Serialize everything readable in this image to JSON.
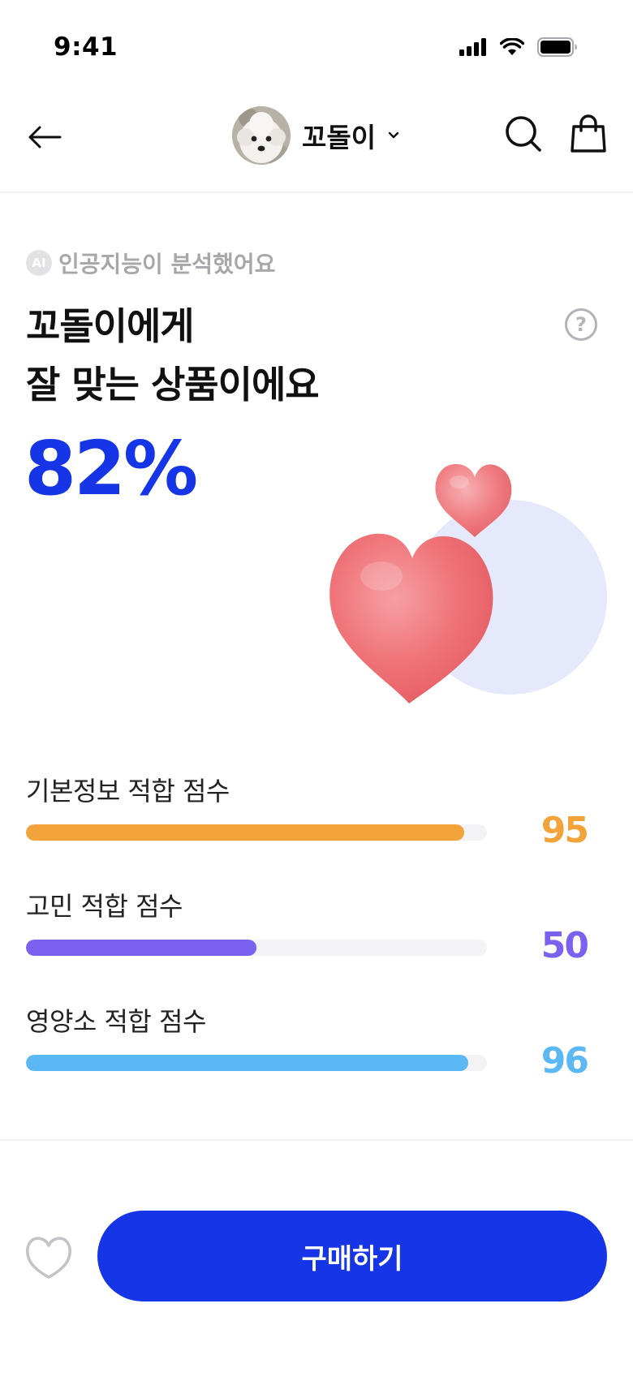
{
  "status_bar": {
    "time": "9:41"
  },
  "header": {
    "pet_name": "꼬돌이"
  },
  "ai": {
    "badge": "AI",
    "label": "인공지능이 분석했어요"
  },
  "headline": {
    "line1": "꼬돌이에게",
    "line2": "잘 맞는 상품이에요",
    "percent": "82%"
  },
  "help": {
    "symbol": "?"
  },
  "scores": [
    {
      "label": "기본정보 적합 점수",
      "value": "95",
      "fill": 0.95,
      "color": "#f2a33a"
    },
    {
      "label": "고민 적합 점수",
      "value": "50",
      "fill": 0.5,
      "color": "#7b61f0"
    },
    {
      "label": "영양소 적합 점수",
      "value": "96",
      "fill": 0.96,
      "color": "#5cb8f5"
    }
  ],
  "actions": {
    "buy_label": "구매하기"
  }
}
